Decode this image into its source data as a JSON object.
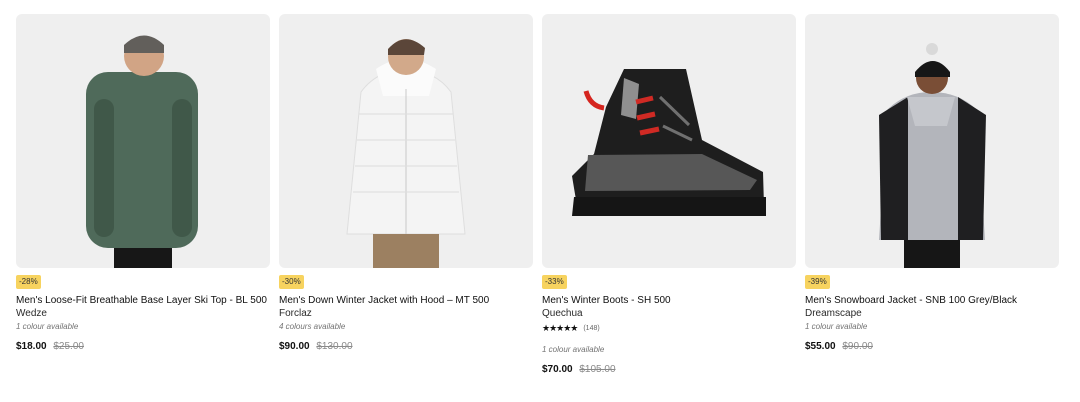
{
  "products": [
    {
      "discount": "-28%",
      "title": "Men's Loose-Fit Breathable Base Layer Ski Top - BL 500",
      "brand": "Wedze",
      "colours": "1 colour available",
      "price": "$18.00",
      "old_price": "$25.00",
      "image": "base-layer-top"
    },
    {
      "discount": "-30%",
      "title": "Men's Down Winter Jacket with Hood – MT 500",
      "brand": "Forclaz",
      "colours": "4 colours available",
      "price": "$90.00",
      "old_price": "$130.00",
      "image": "down-jacket"
    },
    {
      "discount": "-33%",
      "title": "Men's Winter Boots - SH 500",
      "brand": "Quechua",
      "stars": "★★★★★",
      "rating_count": "(148)",
      "colours": "1 colour available",
      "price": "$70.00",
      "old_price": "$105.00",
      "image": "winter-boot"
    },
    {
      "discount": "-39%",
      "title": "Men's Snowboard Jacket - SNB 100 Grey/Black",
      "brand": "Dreamscape",
      "colours": "1 colour available",
      "price": "$55.00",
      "old_price": "$90.00",
      "image": "snowboard-jacket"
    }
  ]
}
